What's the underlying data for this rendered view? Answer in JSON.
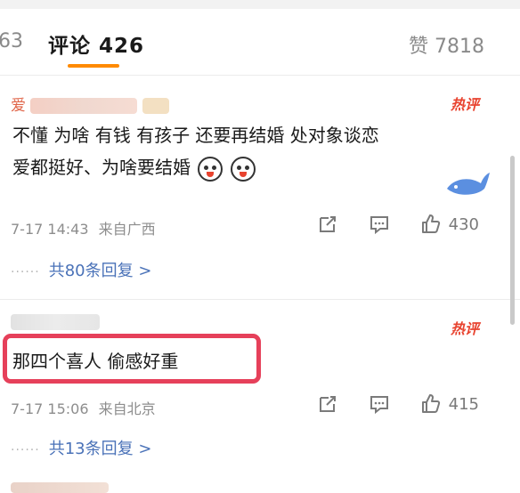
{
  "tabs": {
    "left_partial": "63",
    "comments": "评论 426",
    "likes": "赞 7818"
  },
  "comments": [
    {
      "username": "爱",
      "hot": "热评",
      "text_line1": "不懂 为啥 有钱 有孩子 还要再结婚 处对象谈恋",
      "text_line2": "爱都挺好、为啥要结婚",
      "emoji": "doge-emoji",
      "time": "7-17 14:43",
      "source": "来自广西",
      "likes": "430",
      "replies": "共80条回复 >",
      "dots": "······"
    },
    {
      "username": "",
      "hot": "热评",
      "text": "那四个喜人 偷感好重",
      "time": "7-17 15:06",
      "source": "来自北京",
      "likes": "415",
      "replies": "共13条回复 >",
      "dots": "······"
    }
  ],
  "colors": {
    "accent": "#ff8a00",
    "link": "#4a72b8",
    "hot": "#e8432f",
    "highlight": "#e6405a"
  }
}
